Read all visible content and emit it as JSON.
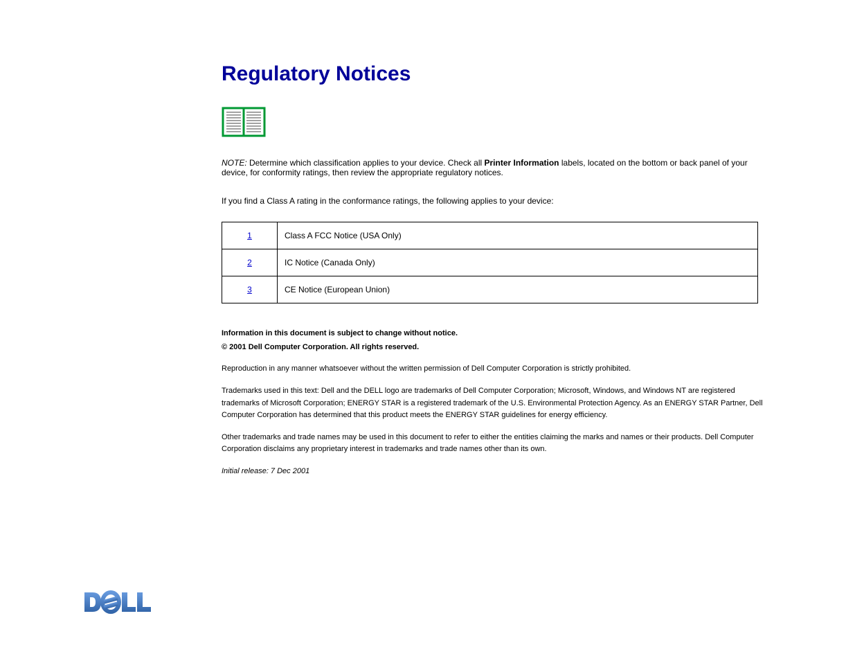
{
  "title": "Regulatory Notices",
  "note": {
    "prefix": "NOTE:",
    "body_before": " Determine which classification applies to your device. Check all ",
    "bold": "Printer Information",
    "body_after": " labels, located on the bottom or back panel of your device, for conformity ratings, then review the appropriate regulatory notices."
  },
  "body_text": "If you find a Class A rating in the conformance ratings, the following applies to your device:",
  "table": [
    {
      "num": "1",
      "text": "Class A FCC Notice (USA Only)"
    },
    {
      "num": "2",
      "text": "IC Notice (Canada Only)"
    },
    {
      "num": "3",
      "text": "CE Notice (European Union)"
    }
  ],
  "copyright": {
    "info_line": "Information in this document is subject to change without notice.",
    "cc_line": "© 2001 Dell Computer Corporation. All rights reserved.",
    "reproduction_line": "Reproduction in any manner whatsoever without the written permission of Dell Computer Corporation is strictly prohibited.",
    "trademarks": "Trademarks used in this text: Dell and the DELL logo are trademarks of Dell Computer Corporation; Microsoft, Windows, and Windows NT are registered trademarks of Microsoft Corporation; ENERGY STAR is a registered trademark of the U.S. Environmental Protection Agency. As an ENERGY STAR Partner, Dell Computer Corporation has determined that this product meets the ENERGY STAR guidelines for energy efficiency.",
    "other_trademarks": "Other trademarks and trade names may be used in this document to refer to either the entities claiming the marks and names or their products. Dell Computer Corporation disclaims any proprietary interest in trademarks and trade names other than its own.",
    "release": "Initial release: 7 Dec 2001"
  }
}
